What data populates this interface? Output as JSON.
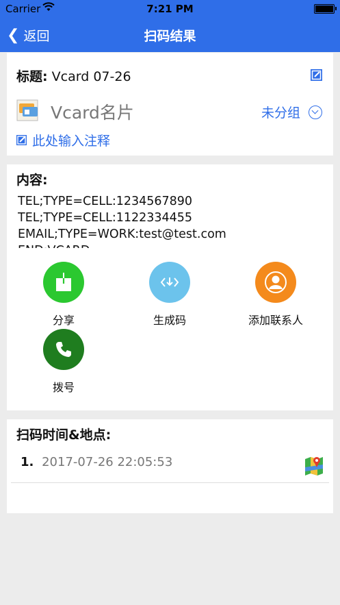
{
  "statusbar": {
    "carrier": "Carrier",
    "time": "7:21 PM"
  },
  "navbar": {
    "back_label": "返回",
    "title": "扫码结果"
  },
  "record": {
    "title_label": "标题:",
    "title_value": "Vcard 07-26",
    "type_name": "Vcard名片",
    "group_label": "未分组",
    "note_placeholder": "此处输入注释"
  },
  "content": {
    "label": "内容:",
    "lines": "TEL;TYPE=CELL:1234567890\nTEL;TYPE=CELL:1122334455\nEMAIL;TYPE=WORK:test@test.com\nEND:VCARD"
  },
  "actions": {
    "share": "分享",
    "generate": "生成码",
    "add_contact": "添加联系人",
    "dial": "拨号"
  },
  "scan": {
    "label": "扫码时间&地点:",
    "entries": [
      {
        "index": "1.",
        "datetime": "2017-07-26 22:05:53"
      }
    ]
  },
  "colors": {
    "accent": "#2f6ee8",
    "share": "#2bc830",
    "generate": "#6cc3ec",
    "add_contact": "#f48a1c",
    "dial": "#1f7d1f"
  },
  "icons": {
    "back": "chevron-left-icon",
    "edit": "edit-icon",
    "vcard": "vcard-icon",
    "group_dropdown": "chevron-down-circle-icon",
    "share": "share-icon",
    "generate": "qr-generate-icon",
    "add_contact": "contact-person-icon",
    "dial": "phone-icon",
    "map": "map-pin-icon"
  }
}
